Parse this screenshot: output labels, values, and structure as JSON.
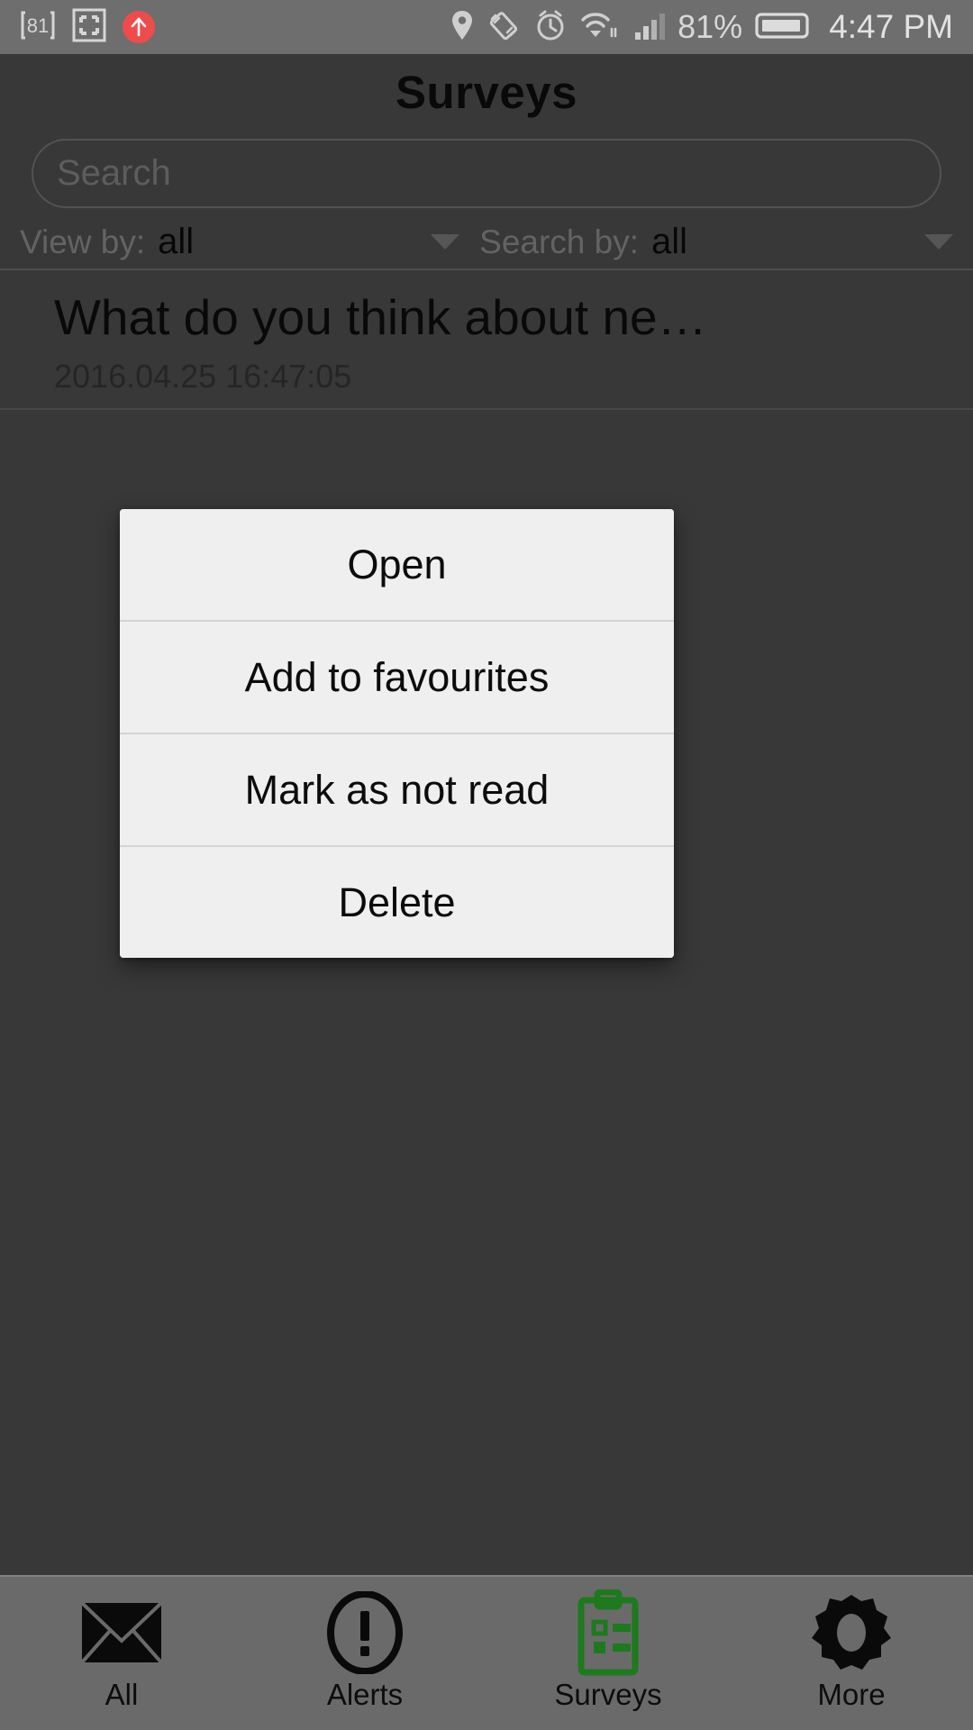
{
  "statusbar": {
    "left_icons": [
      {
        "name": "notification-count-icon",
        "label": "81"
      },
      {
        "name": "screenshot-capture-icon",
        "label": ""
      },
      {
        "name": "upload-arrow-icon",
        "label": ""
      }
    ],
    "right_icons": [
      {
        "name": "location-pin-icon"
      },
      {
        "name": "auto-rotate-icon"
      },
      {
        "name": "alarm-clock-icon"
      },
      {
        "name": "wifi-icon"
      },
      {
        "name": "cellular-signal-icon"
      }
    ],
    "battery_percent": "81%",
    "time": "4:47 PM"
  },
  "header": {
    "title": "Surveys"
  },
  "search": {
    "placeholder": "Search",
    "value": ""
  },
  "filters": {
    "view_by": {
      "label": "View by:",
      "value": "all"
    },
    "search_by": {
      "label": "Search by:",
      "value": "all"
    }
  },
  "list": {
    "items": [
      {
        "title": "What do you think about ne…",
        "timestamp": "2016.04.25 16:47:05"
      }
    ]
  },
  "dialog": {
    "items": [
      {
        "label": "Open"
      },
      {
        "label": "Add to favourites"
      },
      {
        "label": "Mark as not read"
      },
      {
        "label": "Delete"
      }
    ]
  },
  "bottom_nav": {
    "active_index": 2,
    "active_color": "#1d7a1d",
    "tabs": [
      {
        "label": "All",
        "icon": "envelope-icon"
      },
      {
        "label": "Alerts",
        "icon": "exclamation-circle-icon"
      },
      {
        "label": "Surveys",
        "icon": "clipboard-checklist-icon"
      },
      {
        "label": "More",
        "icon": "gear-icon"
      }
    ]
  },
  "colors": {
    "status_bar_bg": "#6e6e6e",
    "app_bg": "#5e5e5e",
    "dialog_bg": "#efeff0",
    "accent_red": "#ef4b4b",
    "surveys_green": "#1d7a1d"
  }
}
